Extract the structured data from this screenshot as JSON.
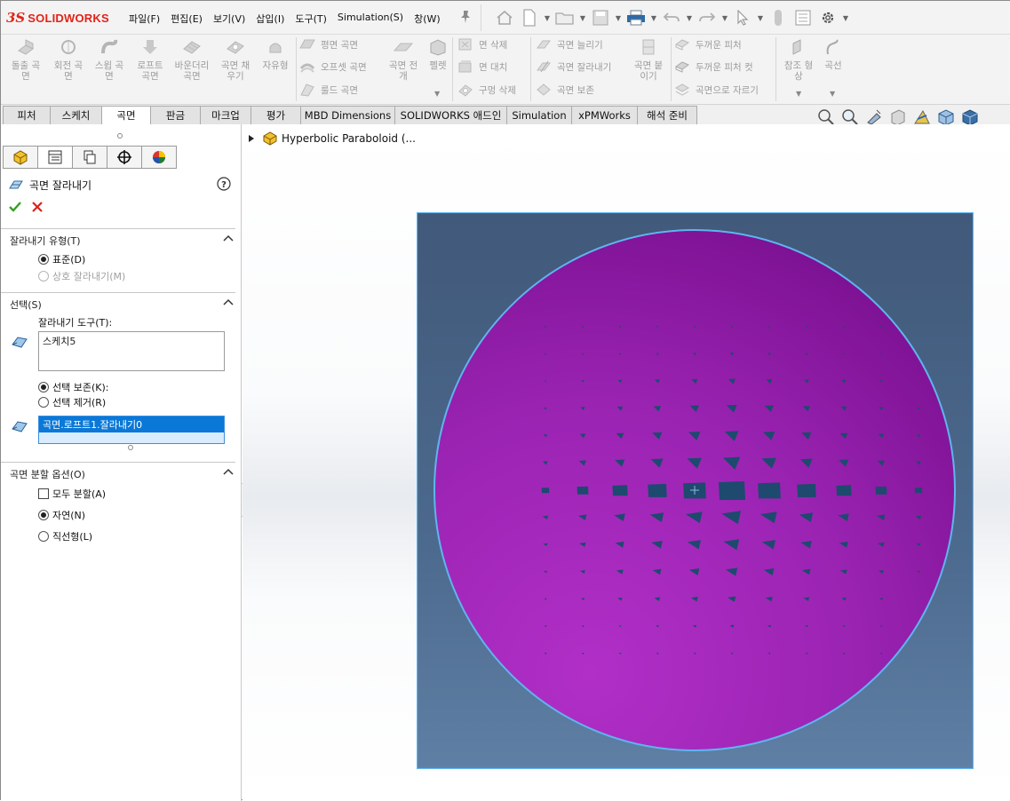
{
  "app": {
    "brand_prefix": "3S",
    "brand_name": "SOLIDWORKS"
  },
  "menu": [
    "파일(F)",
    "편집(E)",
    "보기(V)",
    "삽입(I)",
    "도구(T)",
    "Simulation(S)",
    "창(W)"
  ],
  "ribbon": {
    "big_buttons": [
      {
        "label1": "돌출 곡",
        "label2": "면"
      },
      {
        "label1": "회전 곡",
        "label2": "면"
      },
      {
        "label1": "스윕 곡",
        "label2": "면"
      },
      {
        "label1": "로프트",
        "label2": "곡면"
      },
      {
        "label1": "바운더리",
        "label2": "곡면"
      },
      {
        "label1": "곡면 채",
        "label2": "우기"
      },
      {
        "label1": "자유형",
        "label2": ""
      }
    ],
    "col1": [
      "평면 곡면",
      "오프셋 곡면",
      "룰드 곡면"
    ],
    "spread": {
      "label1": "곡면 전",
      "label2": "개"
    },
    "pallet": "펠렛",
    "col2": [
      "면 삭제",
      "면 대치",
      "구멍 삭제"
    ],
    "col3": [
      "곡면 늘리기",
      "곡면 잘라내기",
      "곡면 보존"
    ],
    "knit": {
      "label1": "곡면 붙",
      "label2": "이기"
    },
    "col4": [
      "두꺼운 피처",
      "두꺼운 피처 컷",
      "곡면으로 자르기"
    ],
    "ref": {
      "label1": "참조 형",
      "label2": "상"
    },
    "curves": "곡선"
  },
  "tabs": [
    "피처",
    "스케치",
    "곡면",
    "판금",
    "마크업",
    "평가",
    "MBD Dimensions",
    "SOLIDWORKS 애드인",
    "Simulation",
    "xPMWorks",
    "해석 준비"
  ],
  "active_tab": "곡면",
  "property_manager": {
    "title": "곡면 잘라내기",
    "trim_type": {
      "header": "잘라내기 유형(T)",
      "standard": "표준(D)",
      "mutual": "상호 잘라내기(M)"
    },
    "selections": {
      "header": "선택(S)",
      "tool_label": "잘라내기 도구(T):",
      "tool_value": "스케치5",
      "keep": "선택 보존(K):",
      "remove": "선택 제거(R)",
      "pieces_value": "곡면.로프트1.잘라내기0"
    },
    "split": {
      "header": "곡면 분할 옵션(O)",
      "split_all": "모두 분할(A)",
      "natural": "자연(N)",
      "linear": "직선형(L)"
    }
  },
  "feature_tree": {
    "part_name": "Hyperbolic Paraboloid (..."
  },
  "colors": {
    "accent_red": "#e2231a",
    "selection_blue": "#0a78d7",
    "viewport_bg": "#4a6688",
    "surface_magenta": "#9422b0",
    "hole_navy": "#1d4a6e",
    "edge_cyan": "#5fb4f0"
  }
}
